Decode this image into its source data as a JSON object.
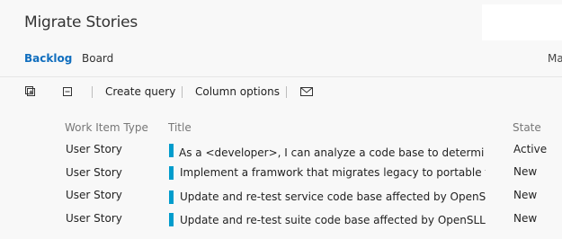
{
  "page": {
    "title": "Migrate Stories"
  },
  "tabs": {
    "backlog": "Backlog",
    "board": "Board",
    "right_truncated": "Ma"
  },
  "toolbar": {
    "expand_icon": "expand-all-icon",
    "collapse_icon": "collapse-all-icon",
    "create_query": "Create query",
    "column_options": "Column options",
    "email_icon": "email-icon"
  },
  "grid": {
    "headers": {
      "type": "Work Item Type",
      "title": "Title",
      "state": "State"
    },
    "accent_color": "#009ccc",
    "rows": [
      {
        "type": "User Story",
        "title": "As a <developer>, I can analyze a code base to determine com...",
        "state": "Active"
      },
      {
        "type": "User Story",
        "title": "Implement a framwork that migrates legacy to portable frame...",
        "state": "New"
      },
      {
        "type": "User Story",
        "title": "Update and re-test service code base affected by OpenSLL cry...",
        "state": "New"
      },
      {
        "type": "User Story",
        "title": "Update and re-test suite code base affected by OpenSLL crypt...",
        "state": "New"
      }
    ]
  }
}
